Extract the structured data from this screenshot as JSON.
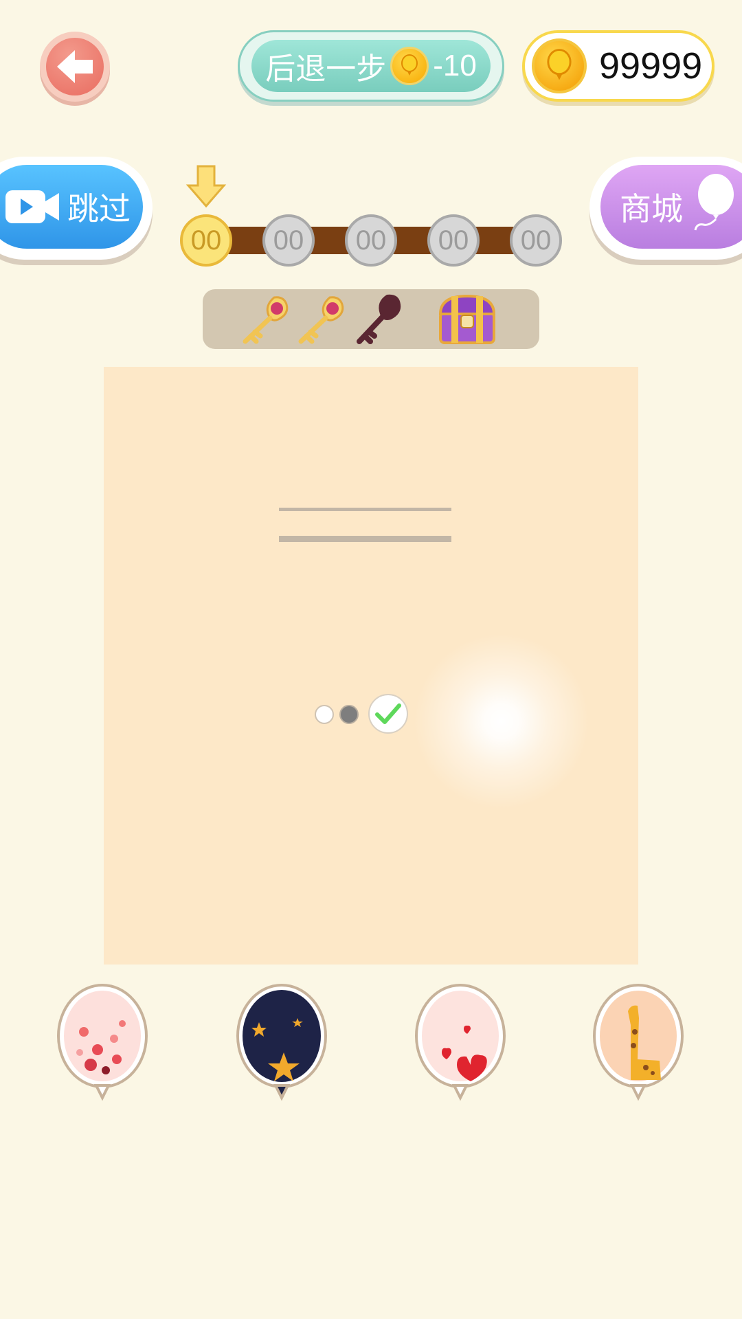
{
  "header": {
    "undo_label": "后退一步",
    "undo_cost": "-10",
    "coins": "99999"
  },
  "side_buttons": {
    "skip_label": "跳过",
    "shop_label": "商城"
  },
  "progress": {
    "nodes": [
      "00",
      "00",
      "00",
      "00",
      "00"
    ],
    "active_index": 0
  },
  "rewards": [
    {
      "icon": "golden-key-icon",
      "collected": true
    },
    {
      "icon": "golden-key-icon",
      "collected": true
    },
    {
      "icon": "key-silhouette-icon",
      "collected": false
    },
    {
      "icon": "treasure-chest-icon"
    }
  ],
  "balloons": [
    {
      "icon": "red-confetti-balloon-icon"
    },
    {
      "icon": "starry-night-balloon-icon"
    },
    {
      "icon": "red-hearts-balloon-icon"
    },
    {
      "icon": "giraffe-balloon-icon"
    }
  ],
  "colors": {
    "background": "#fbf7e5",
    "board": "#fde8c8",
    "skip": "#2f95e8",
    "shop": "#b97ee0",
    "undo": "#79cdbd",
    "coin": "#f7a900"
  }
}
